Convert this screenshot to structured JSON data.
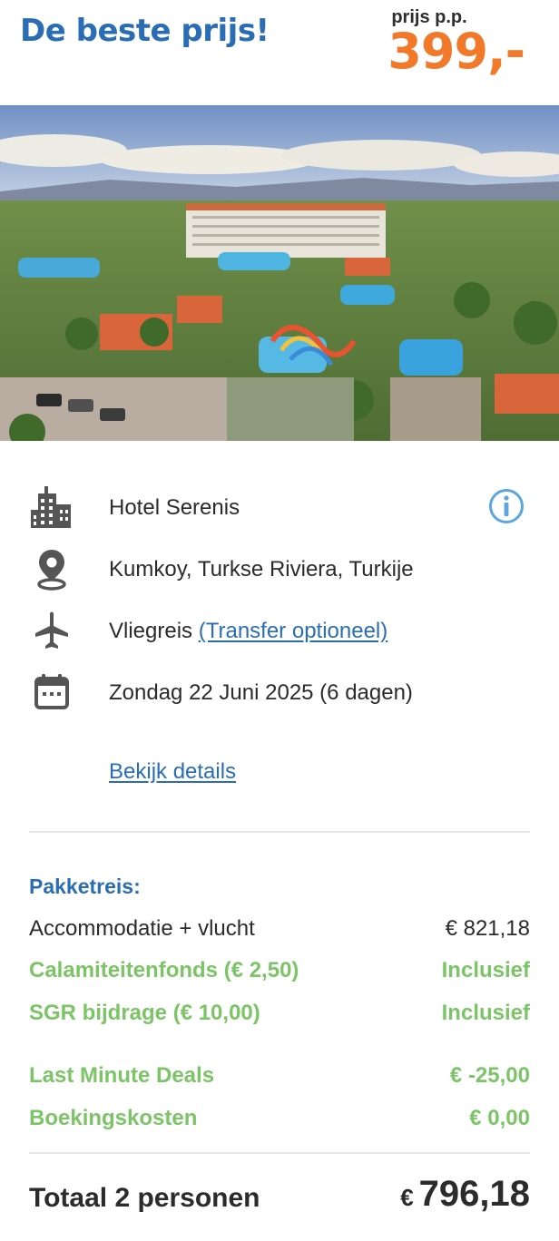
{
  "header": {
    "title": "De beste prijs!",
    "price_label": "prijs p.p.",
    "price_value": "399,-"
  },
  "hotel": {
    "name": "Hotel Serenis",
    "location": "Kumkoy, Turkse Riviera, Turkije",
    "travel_type": "Vliegreis",
    "transfer_link": "(Transfer optioneel)",
    "date": "Zondag 22 Juni 2025 (6 dagen)",
    "details_link": "Bekijk details"
  },
  "icons": {
    "hotel": "building-icon",
    "location": "map-pin-icon",
    "travel": "airplane-icon",
    "date": "calendar-icon",
    "info": "info-icon"
  },
  "pricing": {
    "section_title": "Pakketreis:",
    "rows": [
      {
        "label": "Accommodatie + vlucht",
        "amount": "€ 821,18"
      },
      {
        "label": "Calamiteitenfonds (€ 2,50)",
        "amount": "Inclusief"
      },
      {
        "label": "SGR bijdrage (€ 10,00)",
        "amount": "Inclusief"
      },
      {
        "label": "Last Minute Deals",
        "amount": "€ -25,00"
      },
      {
        "label": "Boekingskosten",
        "amount": "€ 0,00"
      }
    ],
    "total_label": "Totaal 2 personen",
    "total_currency": "€",
    "total_amount": "796,18"
  },
  "colors": {
    "brand_blue": "#2a6db5",
    "price_orange": "#f2782a",
    "green": "#7bc566",
    "text": "#2b2b2b",
    "icon_grey": "#555555"
  }
}
